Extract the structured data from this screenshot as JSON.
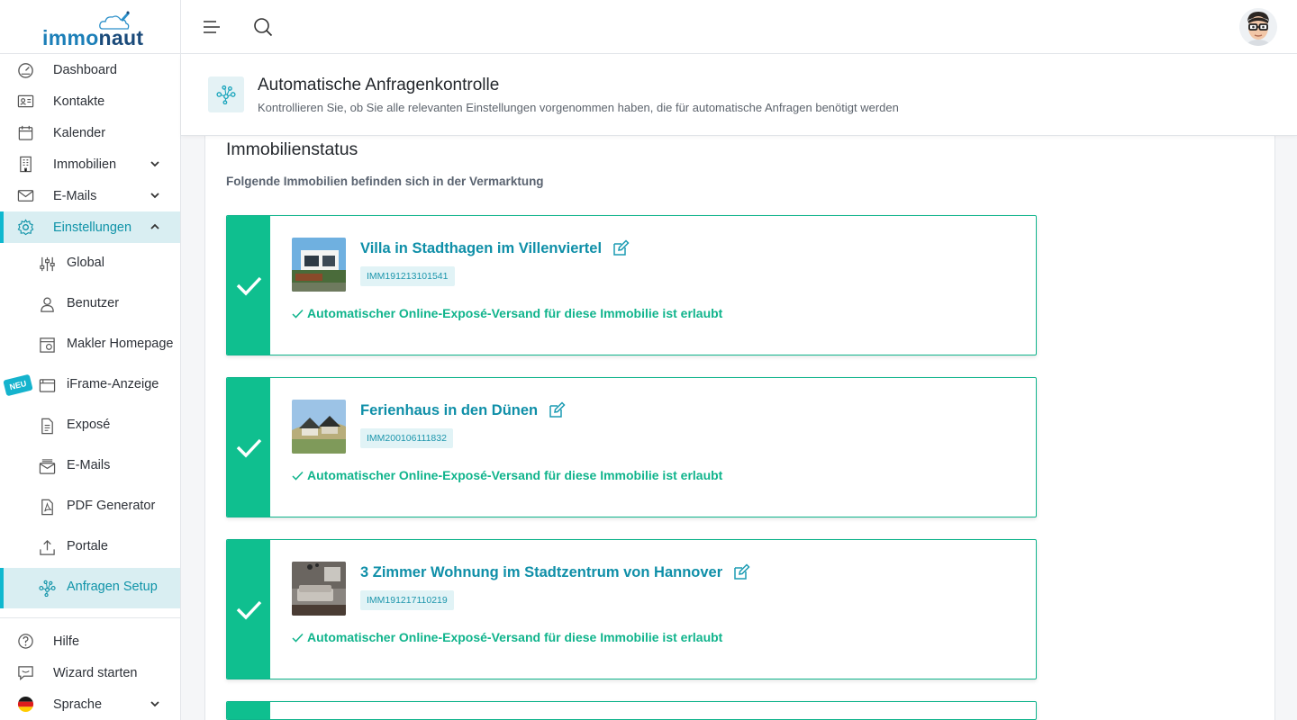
{
  "brand": {
    "name_part1": "immo",
    "name_part2": "naut"
  },
  "sidebar": {
    "items": [
      {
        "label": "Dashboard",
        "icon": "gauge-icon"
      },
      {
        "label": "Kontakte",
        "icon": "contact-card-icon"
      },
      {
        "label": "Kalender",
        "icon": "calendar-icon"
      },
      {
        "label": "Immobilien",
        "icon": "building-icon"
      },
      {
        "label": "E-Mails",
        "icon": "envelope-icon"
      },
      {
        "label": "Einstellungen",
        "icon": "gear-icon"
      }
    ],
    "sub_items": [
      {
        "label": "Global",
        "icon": "sliders-icon"
      },
      {
        "label": "Benutzer",
        "icon": "user-icon"
      },
      {
        "label": "Makler Homepage",
        "icon": "homepage-icon"
      },
      {
        "label": "iFrame-Anzeige",
        "icon": "browser-window-icon"
      },
      {
        "label": "Exposé",
        "icon": "document-icon"
      },
      {
        "label": "E-Mails",
        "icon": "mail-settings-icon"
      },
      {
        "label": "PDF Generator",
        "icon": "pdf-icon"
      },
      {
        "label": "Portale",
        "icon": "upload-tray-icon"
      },
      {
        "label": "Anfragen Setup",
        "icon": "network-icon"
      }
    ],
    "neu_badge": "NEU",
    "bottom_items": [
      {
        "label": "Hilfe",
        "icon": "help-circle-icon"
      },
      {
        "label": "Wizard starten",
        "icon": "chat-icon"
      },
      {
        "label": "Sprache",
        "icon": "flag-germany-icon"
      }
    ]
  },
  "header": {
    "title": "Automatische Anfragenkontrolle",
    "subtitle": "Kontrollieren Sie, ob Sie alle relevanten Einstellungen vorgenommen haben, die für automatische Anfragen benötigt werden"
  },
  "section": {
    "title": "Immobilienstatus",
    "subtitle": "Folgende Immobilien befinden sich in der Vermarktung"
  },
  "properties": [
    {
      "title": "Villa in Stadthagen im Villenviertel",
      "id": "IMM191213101541",
      "note": "Automatischer Online-Exposé-Versand für diese Immobilie ist erlaubt"
    },
    {
      "title": "Ferienhaus in den Dünen",
      "id": "IMM200106111832",
      "note": "Automatischer Online-Exposé-Versand für diese Immobilie ist erlaubt"
    },
    {
      "title": "3 Zimmer Wohnung im Stadtzentrum von Hannover",
      "id": "IMM191217110219",
      "note": "Automatischer Online-Exposé-Versand für diese Immobilie ist erlaubt"
    }
  ],
  "colors": {
    "accent": "#0fb8cf",
    "success": "#0fbf8f",
    "link": "#0f8fa8"
  }
}
